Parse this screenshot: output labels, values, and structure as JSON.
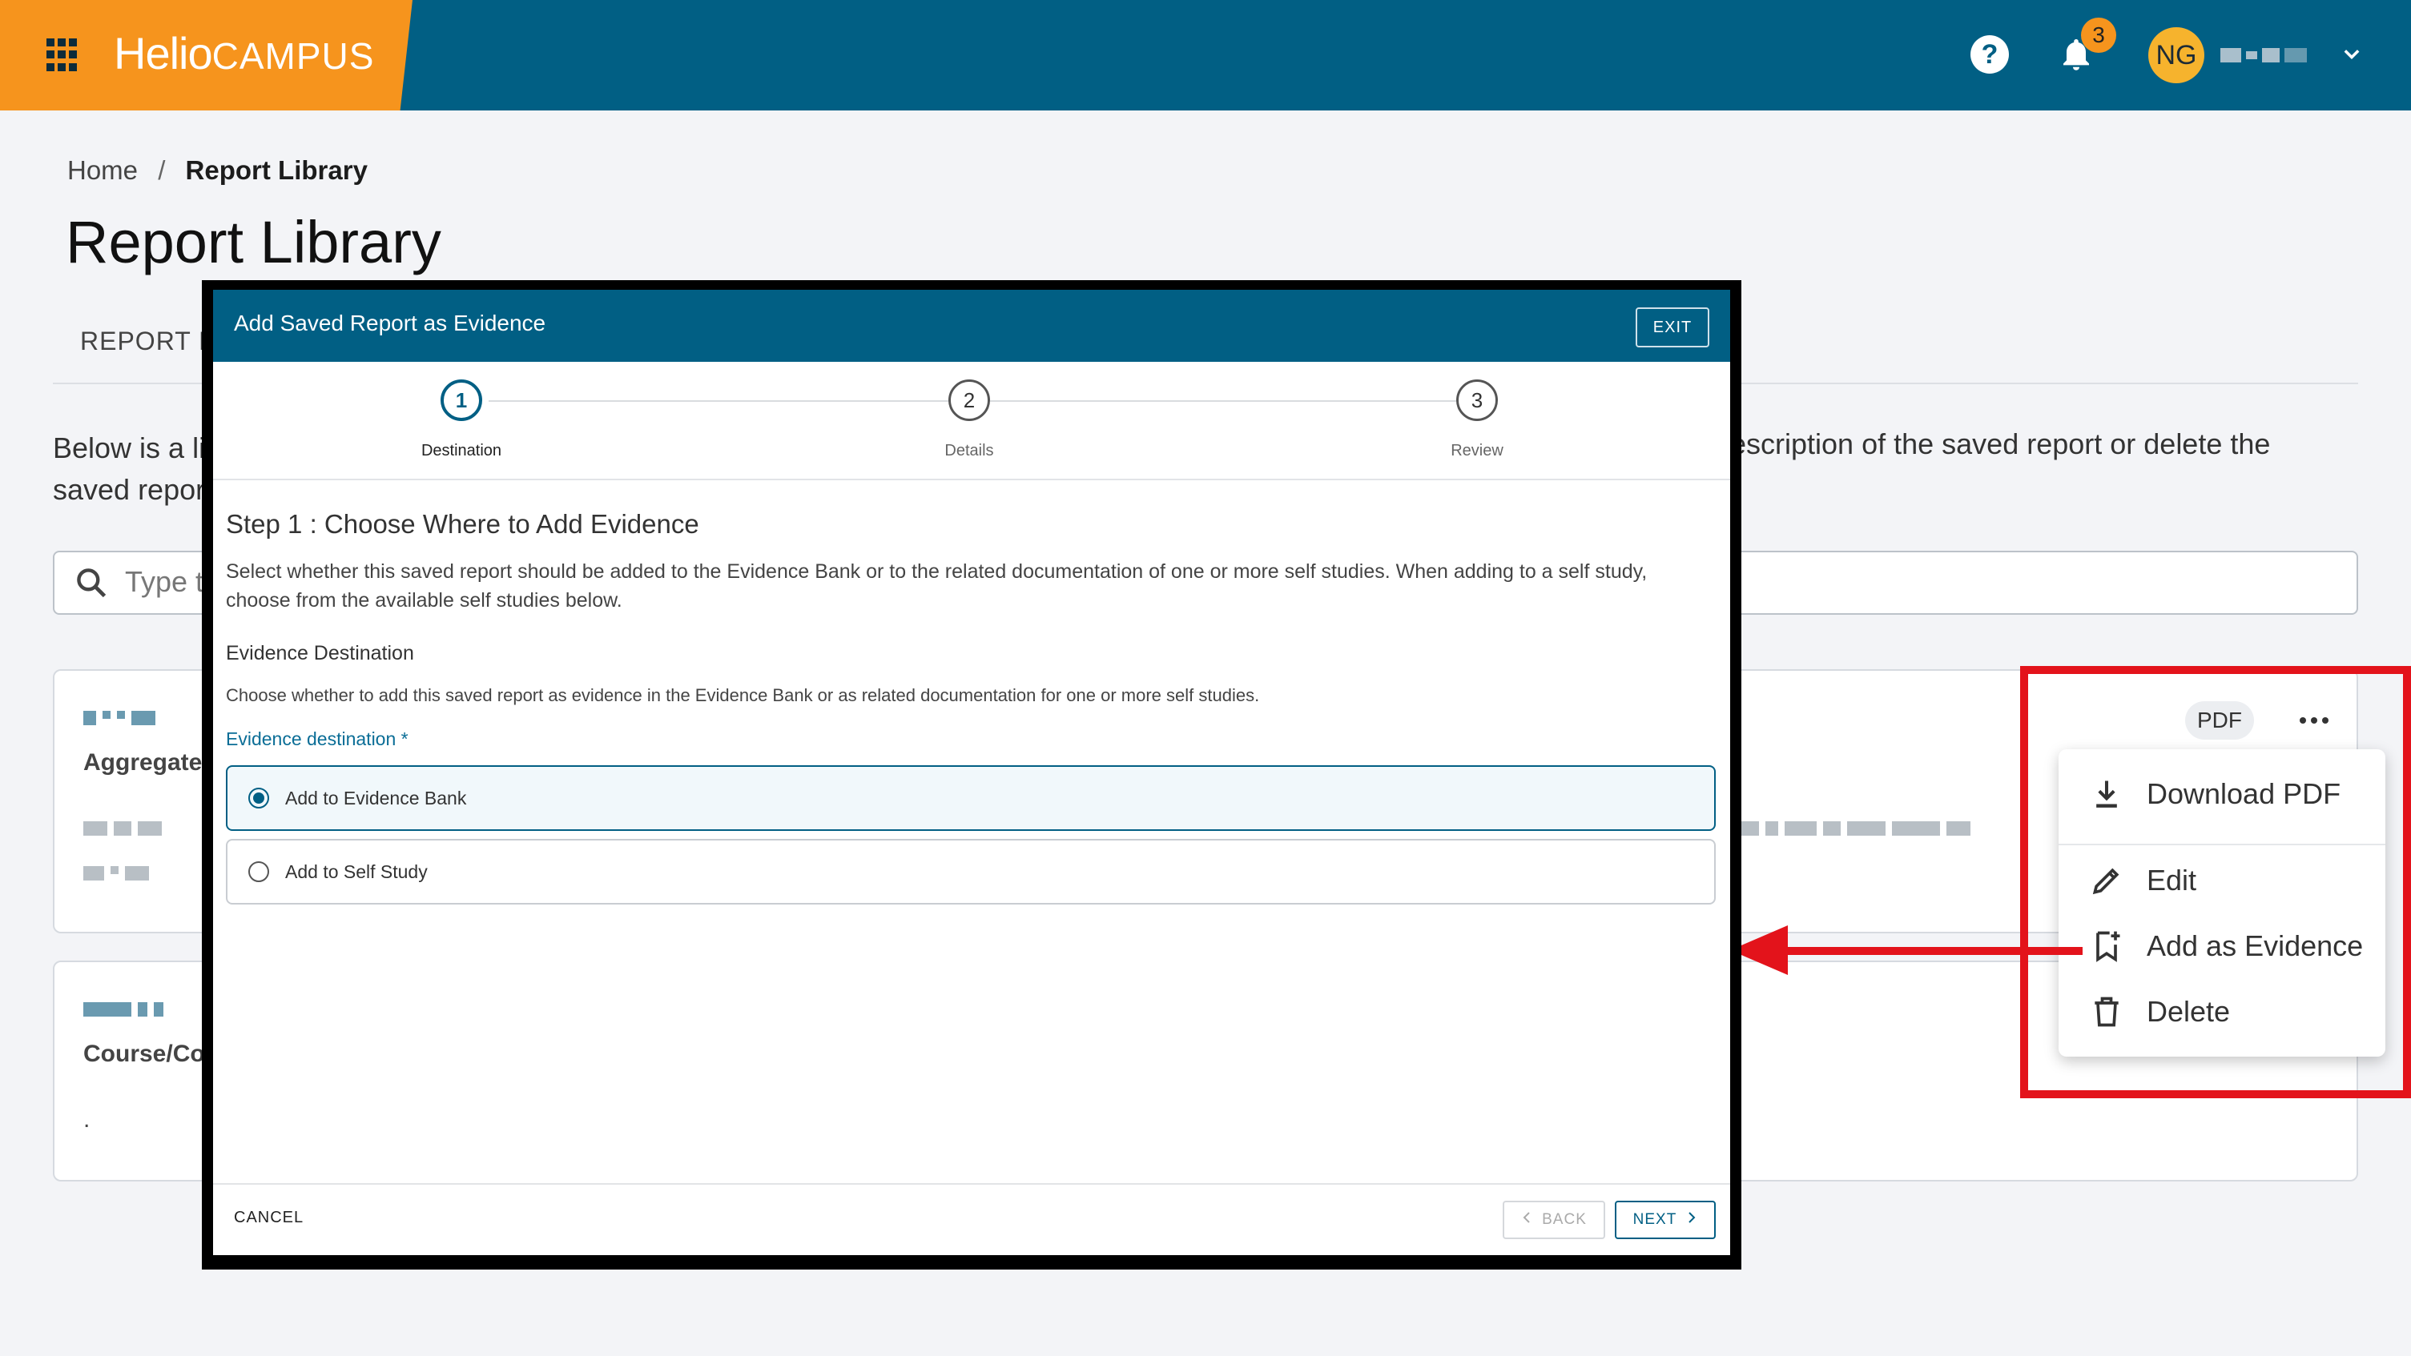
{
  "header": {
    "brand_part1": "Helio",
    "brand_part2": "CAMPUS",
    "help_label": "?",
    "notification_count": "3",
    "user_initials": "NG",
    "colors": {
      "bar": "#015f84",
      "brand": "#f6941d",
      "avatar": "#f6b32d"
    }
  },
  "breadcrumb": {
    "home": "Home",
    "separator": "/",
    "current": "Report Library"
  },
  "page": {
    "title": "Report Library",
    "tab_label": "REPORT LI",
    "desc_left": "Below is a li saved repor",
    "desc_right": "escription of the saved report or delete the",
    "search_placeholder": "Type t"
  },
  "cards": [
    {
      "label": "Aggregate /"
    },
    {
      "label": "Course/Co-",
      "footnote": "."
    }
  ],
  "card_actions": {
    "pdf_chip": "PDF"
  },
  "context_menu": {
    "items": [
      {
        "label": "Download PDF",
        "icon": "download-icon"
      },
      {
        "label": "Edit",
        "icon": "pencil-icon"
      },
      {
        "label": "Add as Evidence",
        "icon": "bookmark-add-icon"
      },
      {
        "label": "Delete",
        "icon": "trash-icon"
      }
    ],
    "highlight_color": "#e3131b"
  },
  "modal": {
    "title": "Add Saved Report as Evidence",
    "exit_label": "EXIT",
    "steps": [
      {
        "number": "1",
        "label": "Destination"
      },
      {
        "number": "2",
        "label": "Details"
      },
      {
        "number": "3",
        "label": "Review"
      }
    ],
    "step_heading": "Step 1 : Choose Where to Add Evidence",
    "step_description": "Select whether this saved report should be added to the Evidence Bank or to the related documentation of one or more self studies. When adding to a self study, choose from the available self studies below.",
    "section_title": "Evidence Destination",
    "section_description": "Choose whether to add this saved report as evidence in the Evidence Bank or as related documentation for one or more self studies.",
    "field_label": "Evidence destination *",
    "options": [
      {
        "label": "Add to Evidence Bank",
        "selected": true
      },
      {
        "label": "Add to Self Study",
        "selected": false
      }
    ],
    "cancel_label": "CANCEL",
    "back_label": "BACK",
    "next_label": "NEXT"
  }
}
